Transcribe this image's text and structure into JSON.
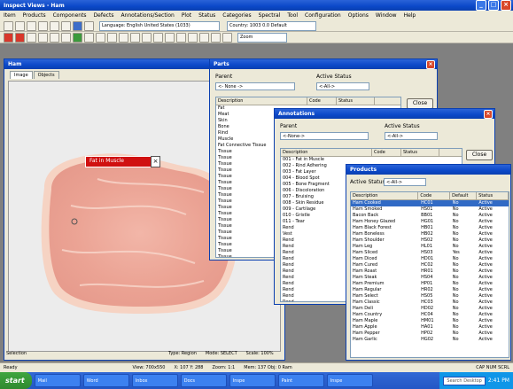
{
  "app": {
    "title": "Inspect Views - Ham",
    "menu": [
      "Item",
      "Products",
      "Components",
      "Defects",
      "Annotations/Section",
      "Plot",
      "Status",
      "Categories",
      "Spectral",
      "Tool",
      "Configuration",
      "Options",
      "Window",
      "Help"
    ],
    "toolbar": {
      "language_label": "Language: English United States (1033)",
      "zoom_label": "Zoom",
      "filter_label": "Country: 1003 0.0 Default"
    }
  },
  "image_window": {
    "title": "Ham",
    "tabs": [
      "Image",
      "Objects"
    ],
    "label_tag": "Fat in Muscle",
    "status": {
      "left": "Selection",
      "type": "Type: Region",
      "mode": "Mode: SELECT",
      "scale": "Scale: 100%"
    }
  },
  "parts": {
    "title": "Parts",
    "parent_label": "Parent",
    "parent_value": "<- None ->",
    "status_label": "Active Status",
    "status_value": "<-All->",
    "close": "Close",
    "columns": [
      "Description",
      "Code",
      "Status"
    ],
    "rows": [
      "Fat",
      "Meat",
      "Skin",
      "Bone",
      "Rind",
      "Muscle",
      "Fat Connective Tissue",
      "Tissue",
      "Tissue",
      "Tissue",
      "Tissue",
      "Tissue",
      "Tissue",
      "Tissue",
      "Tissue",
      "Tissue",
      "Tissue",
      "Tissue",
      "Tissue",
      "Tissue",
      "Tissue",
      "Tissue",
      "Tissue",
      "Tissue",
      "Tissue"
    ]
  },
  "annotations": {
    "title": "Annotations",
    "parent_label": "Parent",
    "parent_value": "<-None->",
    "status_label": "Active Status",
    "status_value": "<-All->",
    "close": "Close",
    "columns": [
      "Description",
      "Code",
      "Status"
    ],
    "rows": [
      "001 - Fat in Muscle",
      "002 - Rind Adhering",
      "003 - Fat Layer",
      "004 - Blood Spot",
      "005 - Bone Fragment",
      "006 - Discoloration",
      "007 - Bruising",
      "008 - Skin Residue",
      "009 - Cartilage",
      "010 - Gristle",
      "011 - Tear",
      "Rend",
      "Vest",
      "Rend",
      "Rend",
      "Rend",
      "Rend",
      "Rend",
      "Rend",
      "Rend",
      "Rend",
      "Rend",
      "Rend",
      "Rend",
      "Rend"
    ]
  },
  "products": {
    "title": "Products",
    "status_label": "Active Status",
    "status_value": "<-All->",
    "columns": [
      "Description",
      "Code",
      "Default",
      "Status"
    ],
    "rows": [
      {
        "d": "Ham Cooked",
        "c": "HC01",
        "def": "No",
        "s": "Active"
      },
      {
        "d": "Ham Smoked",
        "c": "HS01",
        "def": "No",
        "s": "Active"
      },
      {
        "d": "Bacon Back",
        "c": "BB01",
        "def": "No",
        "s": "Active"
      },
      {
        "d": "Ham Honey Glazed",
        "c": "HG01",
        "def": "No",
        "s": "Active"
      },
      {
        "d": "Ham Black Forest",
        "c": "HB01",
        "def": "No",
        "s": "Active"
      },
      {
        "d": "Ham Boneless",
        "c": "HB02",
        "def": "No",
        "s": "Active"
      },
      {
        "d": "Ham Shoulder",
        "c": "HS02",
        "def": "No",
        "s": "Active"
      },
      {
        "d": "Ham Leg",
        "c": "HL01",
        "def": "No",
        "s": "Active"
      },
      {
        "d": "Ham Sliced",
        "c": "HS03",
        "def": "Yes",
        "s": "Active"
      },
      {
        "d": "Ham Diced",
        "c": "HD01",
        "def": "No",
        "s": "Active"
      },
      {
        "d": "Ham Cured",
        "c": "HC02",
        "def": "No",
        "s": "Active"
      },
      {
        "d": "Ham Roast",
        "c": "HR01",
        "def": "No",
        "s": "Active"
      },
      {
        "d": "Ham Steak",
        "c": "HS04",
        "def": "No",
        "s": "Active"
      },
      {
        "d": "Ham Premium",
        "c": "HP01",
        "def": "No",
        "s": "Active"
      },
      {
        "d": "Ham Regular",
        "c": "HR02",
        "def": "No",
        "s": "Active"
      },
      {
        "d": "Ham Select",
        "c": "HS05",
        "def": "No",
        "s": "Active"
      },
      {
        "d": "Ham Classic",
        "c": "HC03",
        "def": "No",
        "s": "Active"
      },
      {
        "d": "Ham Deli",
        "c": "HD02",
        "def": "No",
        "s": "Active"
      },
      {
        "d": "Ham Country",
        "c": "HC04",
        "def": "No",
        "s": "Active"
      },
      {
        "d": "Ham Maple",
        "c": "HM01",
        "def": "No",
        "s": "Active"
      },
      {
        "d": "Ham Apple",
        "c": "HA01",
        "def": "No",
        "s": "Active"
      },
      {
        "d": "Ham Pepper",
        "c": "HP02",
        "def": "No",
        "s": "Active"
      },
      {
        "d": "Ham Garlic",
        "c": "HG02",
        "def": "No",
        "s": "Active"
      }
    ]
  },
  "bottom_status": {
    "left": "Ready",
    "view": "View: 700x550",
    "pos": "X: 107  Y: 288",
    "zoom": "Zoom: 1:1",
    "mem": "Mem: 137  Obj: 0 Ram",
    "right": "CAP  NUM  SCRL"
  },
  "taskbar": {
    "start": "start",
    "tasks": [
      "Mail",
      "Word",
      "Inbox",
      "Docs",
      "Inspe",
      "Paint",
      "Inspe"
    ],
    "search": "Search Desktop",
    "clock": "2:41 PM"
  }
}
